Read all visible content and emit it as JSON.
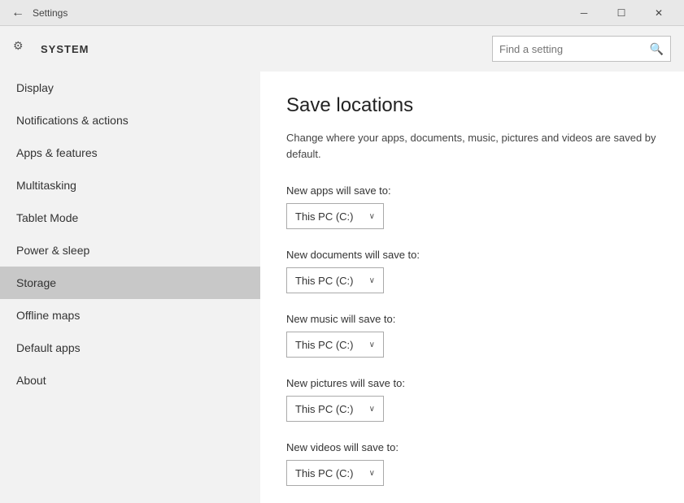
{
  "titlebar": {
    "title": "Settings",
    "back_label": "←",
    "minimize_label": "─",
    "maximize_label": "☐",
    "close_label": "✕"
  },
  "system_header": {
    "icon_label": "⚙",
    "title": "SYSTEM",
    "search_placeholder": "Find a setting",
    "search_icon": "🔍"
  },
  "sidebar": {
    "items": [
      {
        "label": "Display",
        "active": false
      },
      {
        "label": "Notifications & actions",
        "active": false
      },
      {
        "label": "Apps & features",
        "active": false
      },
      {
        "label": "Multitasking",
        "active": false
      },
      {
        "label": "Tablet Mode",
        "active": false
      },
      {
        "label": "Power & sleep",
        "active": false
      },
      {
        "label": "Storage",
        "active": true
      },
      {
        "label": "Offline maps",
        "active": false
      },
      {
        "label": "Default apps",
        "active": false
      },
      {
        "label": "About",
        "active": false
      }
    ]
  },
  "main": {
    "page_title": "Save locations",
    "description": "Change where your apps, documents, music, pictures and videos are saved by default.",
    "settings": [
      {
        "label": "New apps will save to:",
        "value": "This PC (C:)"
      },
      {
        "label": "New documents will save to:",
        "value": "This PC (C:)"
      },
      {
        "label": "New music will save to:",
        "value": "This PC (C:)"
      },
      {
        "label": "New pictures will save to:",
        "value": "This PC (C:)"
      },
      {
        "label": "New videos will save to:",
        "value": "This PC (C:)"
      }
    ]
  }
}
